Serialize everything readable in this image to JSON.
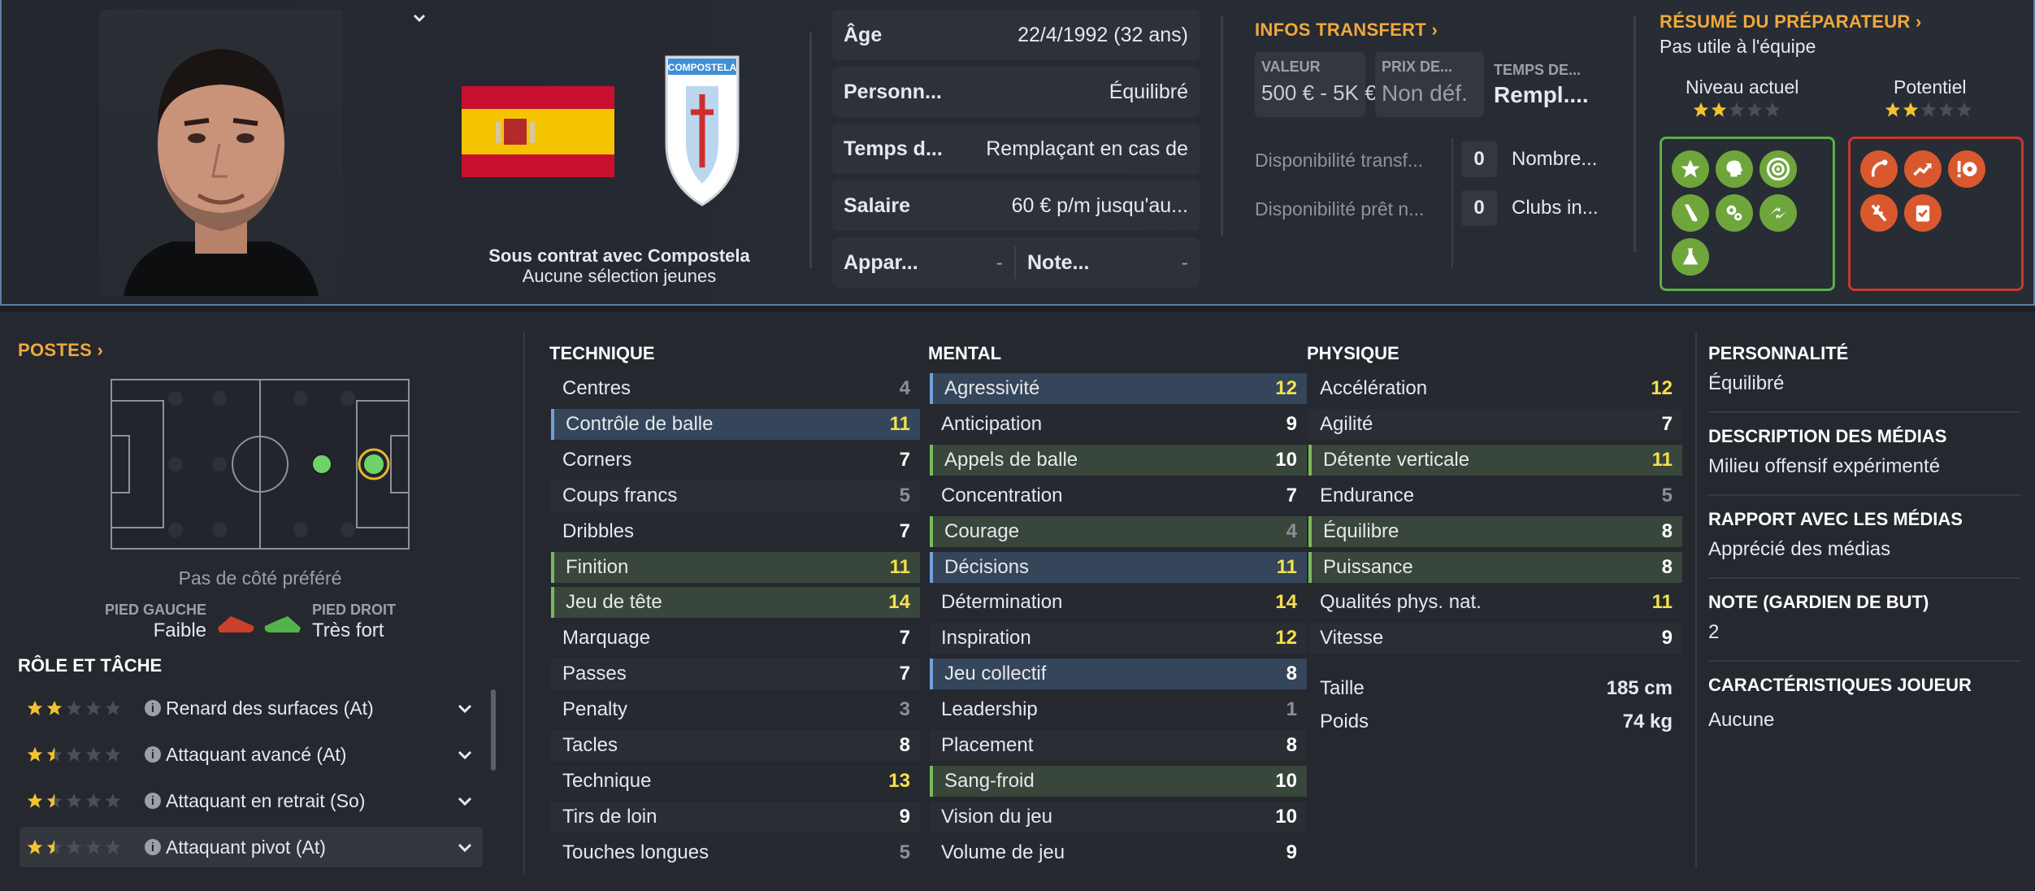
{
  "player": {
    "contract_line": "Sous contrat avec Compostela",
    "youth_line": "Aucune sélection jeunes",
    "crest_text": "COMPOSTELA"
  },
  "info": {
    "age_label": "Âge",
    "age_value": "22/4/1992 (32 ans)",
    "personality_label": "Personn...",
    "personality_value": "Équilibré",
    "playtime_label": "Temps d...",
    "playtime_value": "Remplaçant en cas de",
    "salary_label": "Salaire",
    "salary_value": "60 € p/m jusqu'au...",
    "apps_label": "Appar...",
    "apps_value": "-",
    "rating_label": "Note...",
    "rating_value": "-"
  },
  "transfer": {
    "header": "INFOS TRANSFERT",
    "value_label": "VALEUR",
    "value": "500 € - 5K €",
    "price_label": "PRIX DE...",
    "price": "Non déf.",
    "time_label": "TEMPS DE...",
    "time": "Rempl....",
    "avail_transfer": "Disponibilité transf...",
    "avail_loan": "Disponibilité prêt n...",
    "count1": "0",
    "count1_label": "Nombre...",
    "count2": "0",
    "count2_label": "Clubs in..."
  },
  "coach": {
    "header": "RÉSUMÉ DU PRÉPARATEUR",
    "summary": "Pas utile à l'équipe",
    "current_label": "Niveau actuel",
    "potential_label": "Potentiel",
    "current_stars": 2,
    "potential_stars": 2,
    "strengths_icons": [
      "star-icon",
      "head-icon",
      "target-icon",
      "boot-icon",
      "gears-icon",
      "arrows-icon",
      "flask-icon"
    ],
    "weakness_icons": [
      "curve-icon",
      "trend-up-icon",
      "alert-ball-icon",
      "tackle-icon",
      "clipboard-icon"
    ]
  },
  "positions": {
    "header": "POSTES",
    "side_pref": "Pas de côté préféré",
    "left_foot_label": "PIED GAUCHE",
    "left_foot_value": "Faible",
    "right_foot_label": "PIED DROIT",
    "right_foot_value": "Très fort"
  },
  "roles": {
    "header": "RÔLE ET TÂCHE",
    "items": [
      {
        "label": "Renard des surfaces (At)",
        "stars": 2
      },
      {
        "label": "Attaquant avancé (At)",
        "stars": 1.5
      },
      {
        "label": "Attaquant en retrait (So)",
        "stars": 1.5
      },
      {
        "label": "Attaquant pivot (At)",
        "stars": 1.5
      }
    ]
  },
  "technique": {
    "header": "TECHNIQUE",
    "rows": [
      {
        "name": "Centres",
        "value": "4"
      },
      {
        "name": "Contrôle de balle",
        "value": "11"
      },
      {
        "name": "Corners",
        "value": "7"
      },
      {
        "name": "Coups francs",
        "value": "5"
      },
      {
        "name": "Dribbles",
        "value": "7"
      },
      {
        "name": "Finition",
        "value": "11"
      },
      {
        "name": "Jeu de tête",
        "value": "14"
      },
      {
        "name": "Marquage",
        "value": "7"
      },
      {
        "name": "Passes",
        "value": "7"
      },
      {
        "name": "Penalty",
        "value": "3"
      },
      {
        "name": "Tacles",
        "value": "8"
      },
      {
        "name": "Technique",
        "value": "13"
      },
      {
        "name": "Tirs de loin",
        "value": "9"
      },
      {
        "name": "Touches longues",
        "value": "5"
      }
    ]
  },
  "mental": {
    "header": "MENTAL",
    "rows": [
      {
        "name": "Agressivité",
        "value": "12"
      },
      {
        "name": "Anticipation",
        "value": "9"
      },
      {
        "name": "Appels de balle",
        "value": "10"
      },
      {
        "name": "Concentration",
        "value": "7"
      },
      {
        "name": "Courage",
        "value": "4"
      },
      {
        "name": "Décisions",
        "value": "11"
      },
      {
        "name": "Détermination",
        "value": "14"
      },
      {
        "name": "Inspiration",
        "value": "12"
      },
      {
        "name": "Jeu collectif",
        "value": "8"
      },
      {
        "name": "Leadership",
        "value": "1"
      },
      {
        "name": "Placement",
        "value": "8"
      },
      {
        "name": "Sang-froid",
        "value": "10"
      },
      {
        "name": "Vision du jeu",
        "value": "10"
      },
      {
        "name": "Volume de jeu",
        "value": "9"
      }
    ]
  },
  "physique": {
    "header": "PHYSIQUE",
    "rows": [
      {
        "name": "Accélération",
        "value": "12"
      },
      {
        "name": "Agilité",
        "value": "7"
      },
      {
        "name": "Détente verticale",
        "value": "11"
      },
      {
        "name": "Endurance",
        "value": "5"
      },
      {
        "name": "Équilibre",
        "value": "8"
      },
      {
        "name": "Puissance",
        "value": "8"
      },
      {
        "name": "Qualités phys. nat.",
        "value": "11"
      },
      {
        "name": "Vitesse",
        "value": "9"
      }
    ],
    "height_label": "Taille",
    "height": "185 cm",
    "weight_label": "Poids",
    "weight": "74 kg"
  },
  "side": {
    "personality_h": "PERSONNALITÉ",
    "personality": "Équilibré",
    "media_desc_h": "DESCRIPTION DES MÉDIAS",
    "media_desc": "Milieu offensif expérimenté",
    "media_rel_h": "RAPPORT AVEC LES MÉDIAS",
    "media_rel": "Apprécié des médias",
    "gk_h": "NOTE (GARDIEN DE BUT)",
    "gk": "2",
    "traits_h": "CARACTÉRISTIQUES JOUEUR",
    "traits": "Aucune"
  },
  "colors": {
    "accent": "#f0a93a",
    "highlight_yellow": "#f4e04d",
    "good": "#6ea63c",
    "bad": "#d9582e",
    "frame": "#5a7fa6"
  }
}
